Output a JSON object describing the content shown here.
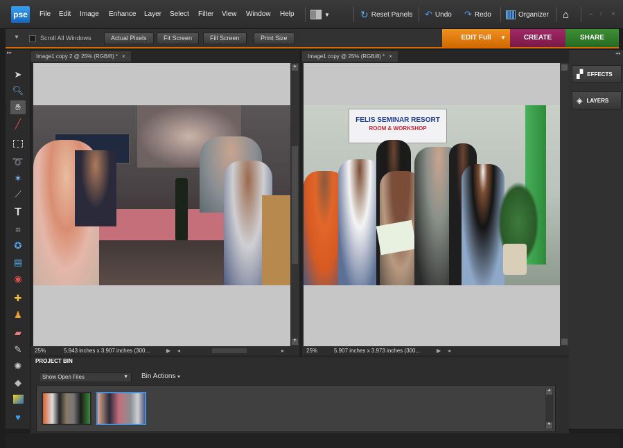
{
  "app": {
    "logo": "pse"
  },
  "menu": [
    "File",
    "Edit",
    "Image",
    "Enhance",
    "Layer",
    "Select",
    "Filter",
    "View",
    "Window",
    "Help"
  ],
  "menubar": {
    "reset_panels": "Reset Panels",
    "undo": "Undo",
    "redo": "Redo",
    "organizer": "Organizer"
  },
  "options": {
    "scroll_all_windows": "Scroll All Windows",
    "actual_pixels": "Actual Pixels",
    "fit_screen": "Fit Screen",
    "fill_screen": "Fill Screen",
    "print_size": "Print Size"
  },
  "modes": {
    "edit": "EDIT Full",
    "create": "CREATE",
    "share": "SHARE"
  },
  "documents": [
    {
      "tab": "Image1 copy 2 @ 25% (RGB/8) *",
      "zoom": "25%",
      "size": "5.943 inches x 3.907 inches (300..."
    },
    {
      "tab": "Image1 copy @ 25% (RGB/8) *",
      "zoom": "25%",
      "size": "5.907 inches x 3.973 inches (300..."
    }
  ],
  "panels": {
    "effects": "EFFECTS",
    "layers": "LAYERS"
  },
  "bin": {
    "title": "PROJECT BIN",
    "show": "Show Open Files",
    "actions": "Bin Actions"
  },
  "photo_text": {
    "banner_line1": "FELIS SEMINAR RESORT",
    "banner_line2": "ROOM & WORKSHOP"
  },
  "colors": {
    "accent_edit": "#e07a10",
    "accent_create": "#8a1d55",
    "accent_share": "#2f7a2a",
    "selection": "#4a8fd8"
  },
  "icons": [
    "move-icon",
    "zoom-icon",
    "hand-icon",
    "eyedropper-icon",
    "marquee-icon",
    "lasso-icon",
    "magic-wand-icon",
    "selection-brush-icon",
    "type-icon",
    "crop-icon",
    "cookie-cutter-icon",
    "straighten-icon",
    "red-eye-icon",
    "healing-brush-icon",
    "clone-stamp-icon",
    "eraser-icon",
    "brush-icon",
    "smart-brush-icon",
    "paint-bucket-icon",
    "gradient-icon",
    "custom-shape-icon"
  ]
}
